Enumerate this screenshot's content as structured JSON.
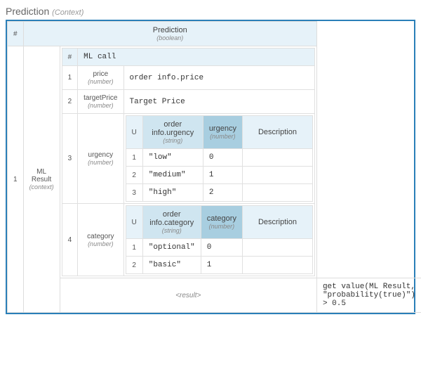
{
  "title": "Prediction",
  "title_type": "(Context)",
  "header": {
    "name": "Prediction",
    "type": "(boolean)"
  },
  "row_index": "1",
  "ml_result_label": "ML Result",
  "ml_result_type": "(context)",
  "ml_call_label": "ML call",
  "hash": "#",
  "u": "U",
  "desc": "Description",
  "params": [
    {
      "idx": "1",
      "name": "price",
      "type": "(number)",
      "value": "order info.price"
    },
    {
      "idx": "2",
      "name": "targetPrice",
      "type": "(number)",
      "value": "Target Price"
    },
    {
      "idx": "3",
      "name": "urgency",
      "type": "(number)"
    },
    {
      "idx": "4",
      "name": "category",
      "type": "(number)"
    }
  ],
  "urgency_table": {
    "col1": {
      "name": "order info.urgency",
      "type": "(string)"
    },
    "col2": {
      "name": "urgency",
      "type": "(number)"
    },
    "rows": [
      {
        "idx": "1",
        "v1": "\"low\"",
        "v2": "0"
      },
      {
        "idx": "2",
        "v1": "\"medium\"",
        "v2": "1"
      },
      {
        "idx": "3",
        "v1": "\"high\"",
        "v2": "2"
      }
    ]
  },
  "category_table": {
    "col1": {
      "name": "order info.category",
      "type": "(string)"
    },
    "col2": {
      "name": "category",
      "type": "(number)"
    },
    "rows": [
      {
        "idx": "1",
        "v1": "\"optional\"",
        "v2": "0"
      },
      {
        "idx": "2",
        "v1": "\"basic\"",
        "v2": "1"
      }
    ]
  },
  "result_label": "<result>",
  "result_expr": "get value(ML Result, \"probability(true)\") > 0.5"
}
